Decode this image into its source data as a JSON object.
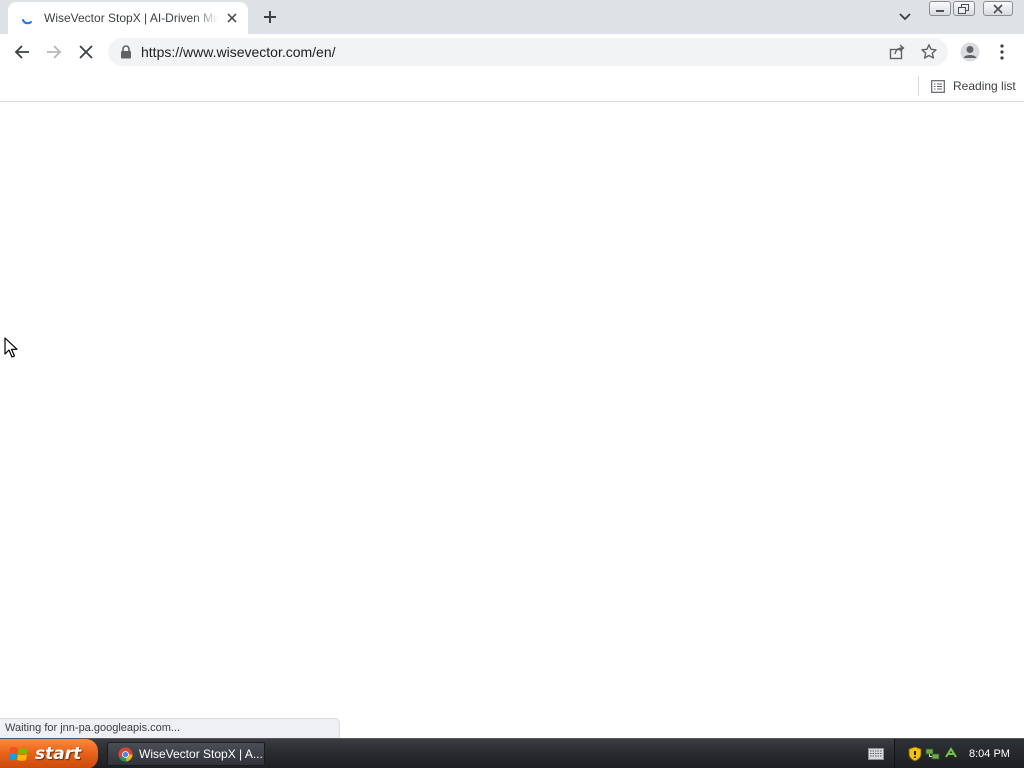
{
  "browser": {
    "tab": {
      "title": "WiseVector StopX | AI-Driven Malware",
      "loading": true,
      "favicon": "loading-spinner-icon",
      "close_icon": "close-icon"
    },
    "new_tab_icon": "plus-icon",
    "tab_search_icon": "chevron-down-icon",
    "window_controls": [
      "minimize-icon",
      "restore-icon",
      "close-icon"
    ],
    "toolbar": {
      "back_icon": "back-arrow-icon",
      "forward_icon": "forward-arrow-icon",
      "stop_icon": "stop-icon",
      "url": "https://www.wisevector.com/en/",
      "share_icon": "share-icon",
      "bookmark_icon": "star-icon",
      "profile_icon": "profile-icon",
      "menu_icon": "kebab-menu-icon"
    },
    "bookmarks_bar": {
      "reading_list_label": "Reading list"
    },
    "status_text": "Waiting for jnn-pa.googleapis.com..."
  },
  "taskbar": {
    "start_label": "start",
    "items": [
      {
        "label": "WiseVector StopX | A...",
        "icon": "chrome-icon",
        "active": true
      }
    ],
    "clock": "8:04 PM"
  },
  "colors": {
    "tabstrip_bg": "#dee1e6",
    "omnibox_bg": "#f1f3f4",
    "spinner": "#1a73e8",
    "start_button": "#e8641b",
    "taskbar_bg": "#2a2c30"
  }
}
